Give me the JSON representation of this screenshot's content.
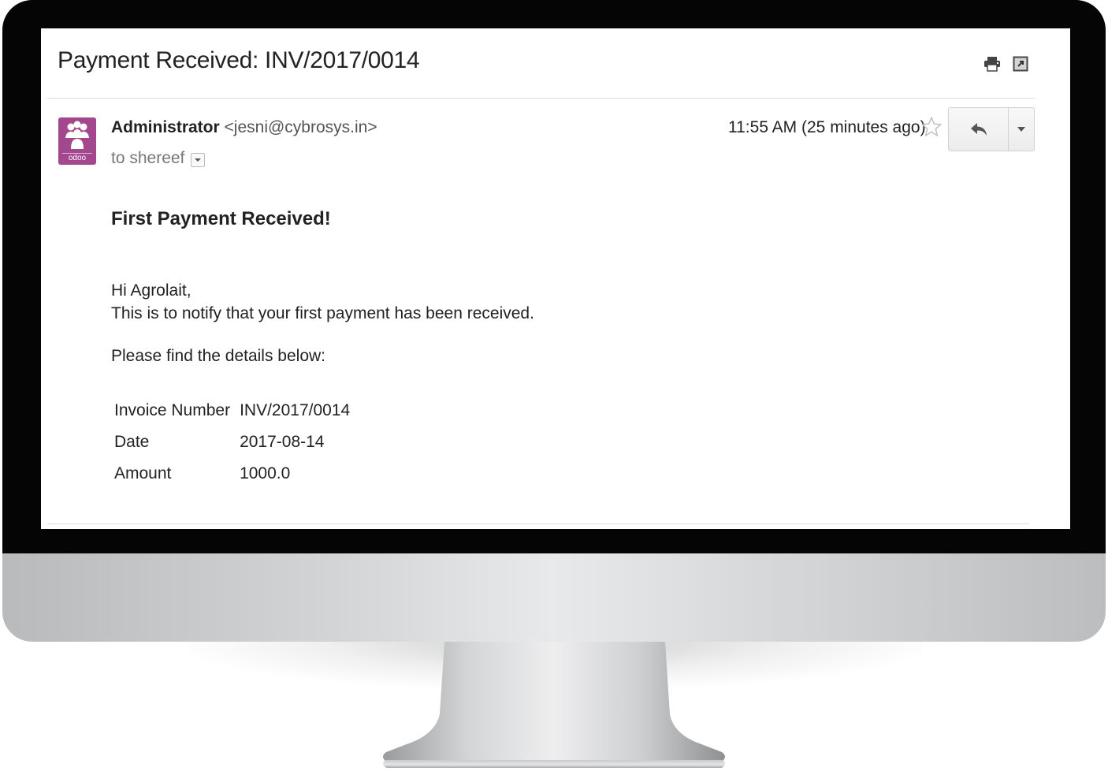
{
  "email": {
    "subject": "Payment Received: INV/2017/0014",
    "avatar_text": "odoo",
    "sender_name": "Administrator",
    "sender_email": "<jesni@cybrosys.in>",
    "recipient": "to shereef",
    "timestamp": "11:55 AM (25 minutes ago)",
    "body": {
      "heading": "First Payment Received!",
      "greeting_line1": "Hi Agrolait,",
      "greeting_line2": "This is to notify that your first payment has been received.",
      "details_intro": "Please find the details below:",
      "details": [
        {
          "label": "Invoice Number",
          "value": "INV/2017/0014"
        },
        {
          "label": "Date",
          "value": "2017-08-14"
        },
        {
          "label": "Amount",
          "value": "1000.0"
        }
      ]
    }
  },
  "icons": {
    "print": "print-icon",
    "new_window": "new-window-icon",
    "star": "star-icon",
    "reply": "reply-icon",
    "more": "chevron-down-icon",
    "recipient_details": "chevron-down-icon"
  },
  "colors": {
    "avatar": "#a3478f",
    "bezel": "#050505",
    "text": "#222222"
  }
}
